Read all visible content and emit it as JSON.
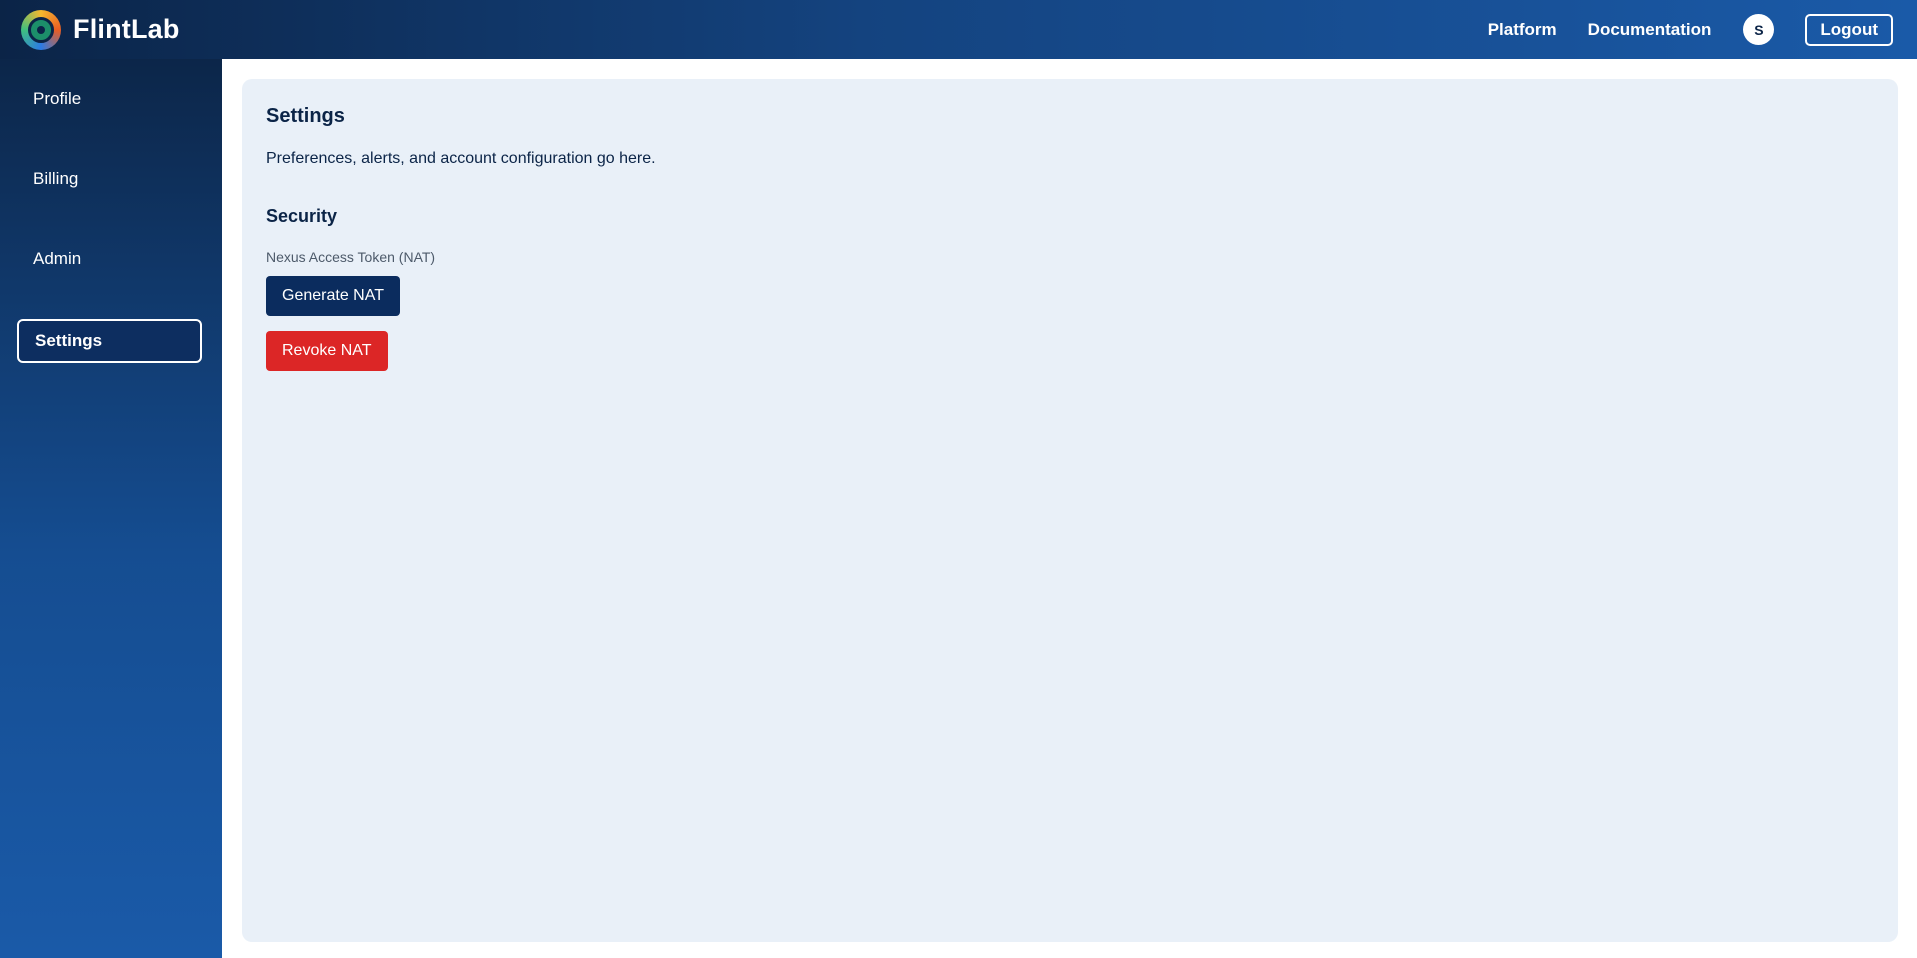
{
  "header": {
    "brand": "FlintLab",
    "nav": [
      {
        "label": "Platform"
      },
      {
        "label": "Documentation"
      }
    ],
    "avatar_initial": "S",
    "logout_label": "Logout"
  },
  "sidebar": {
    "items": [
      {
        "label": "Profile"
      },
      {
        "label": "Billing"
      },
      {
        "label": "Admin"
      },
      {
        "label": "Settings",
        "active": true
      }
    ]
  },
  "main": {
    "title": "Settings",
    "description": "Preferences, alerts, and account configuration go here.",
    "security": {
      "heading": "Security",
      "token_label": "Nexus Access Token (NAT)",
      "generate_label": "Generate NAT",
      "revoke_label": "Revoke NAT"
    }
  },
  "colors": {
    "primary_dark": "#0b2447",
    "accent_blue": "#1a5aa8",
    "panel_bg": "#e9f0f8",
    "danger": "#dc2626",
    "button_primary": "#0b2c5e"
  },
  "icons": {
    "logo": "flintlab-logo-icon"
  }
}
